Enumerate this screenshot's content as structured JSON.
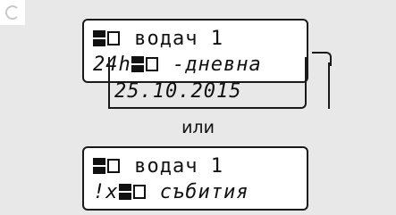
{
  "display1": {
    "line1": "водач 1",
    "line2": "24h",
    "line2_suffix": " -дневна",
    "line3": "25.10.2015"
  },
  "separator": "или",
  "display2": {
    "line1": "водач 1",
    "line2": "!x",
    "line2_suffix": " събития"
  },
  "icons": {
    "card_icon": "card-slot-icon",
    "card_filled_icon": "card-filled-icon"
  },
  "colors": {
    "background": "#e8e8e8",
    "display_border": "#1a1a1a",
    "display_bg": "#ffffff"
  }
}
